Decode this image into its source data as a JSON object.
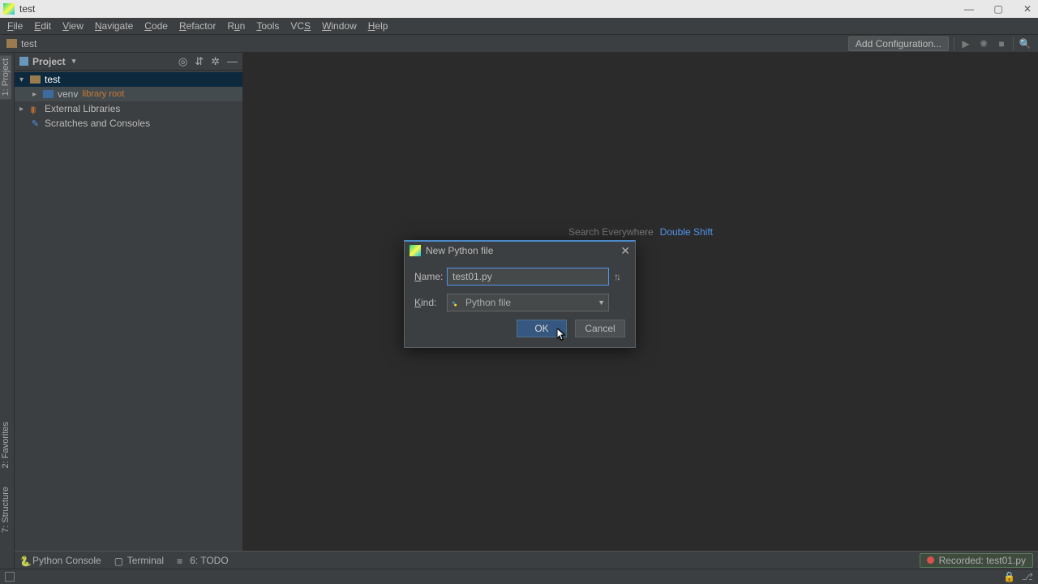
{
  "window": {
    "title": "test"
  },
  "menu": [
    "File",
    "Edit",
    "View",
    "Navigate",
    "Code",
    "Refactor",
    "Run",
    "Tools",
    "VCS",
    "Window",
    "Help"
  ],
  "breadcrumb": {
    "project": "test"
  },
  "toolbar": {
    "add_config": "Add Configuration..."
  },
  "project_tool": {
    "header": "Project",
    "items": [
      {
        "label": "test",
        "expanded": true,
        "type": "folder",
        "selected": true
      },
      {
        "label": "venv",
        "hint": "library root",
        "type": "package",
        "indent": 1
      },
      {
        "label": "External Libraries",
        "type": "library"
      },
      {
        "label": "Scratches and Consoles",
        "type": "scratch"
      }
    ]
  },
  "left_gutter": [
    "1: Project",
    "7: Structure",
    "2: Favorites"
  ],
  "hints": {
    "line1": "Search Everywhere",
    "line1_shortcut": "Double Shift"
  },
  "dialog": {
    "title": "New Python file",
    "name_label": "Name:",
    "name_value": "test01.py",
    "kind_label": "Kind:",
    "kind_value": "Python file",
    "ok": "OK",
    "cancel": "Cancel"
  },
  "bottom": {
    "python_console": "Python Console",
    "terminal": "Terminal",
    "todo": "6: TODO",
    "recorded": "Recorded: test01.py"
  }
}
